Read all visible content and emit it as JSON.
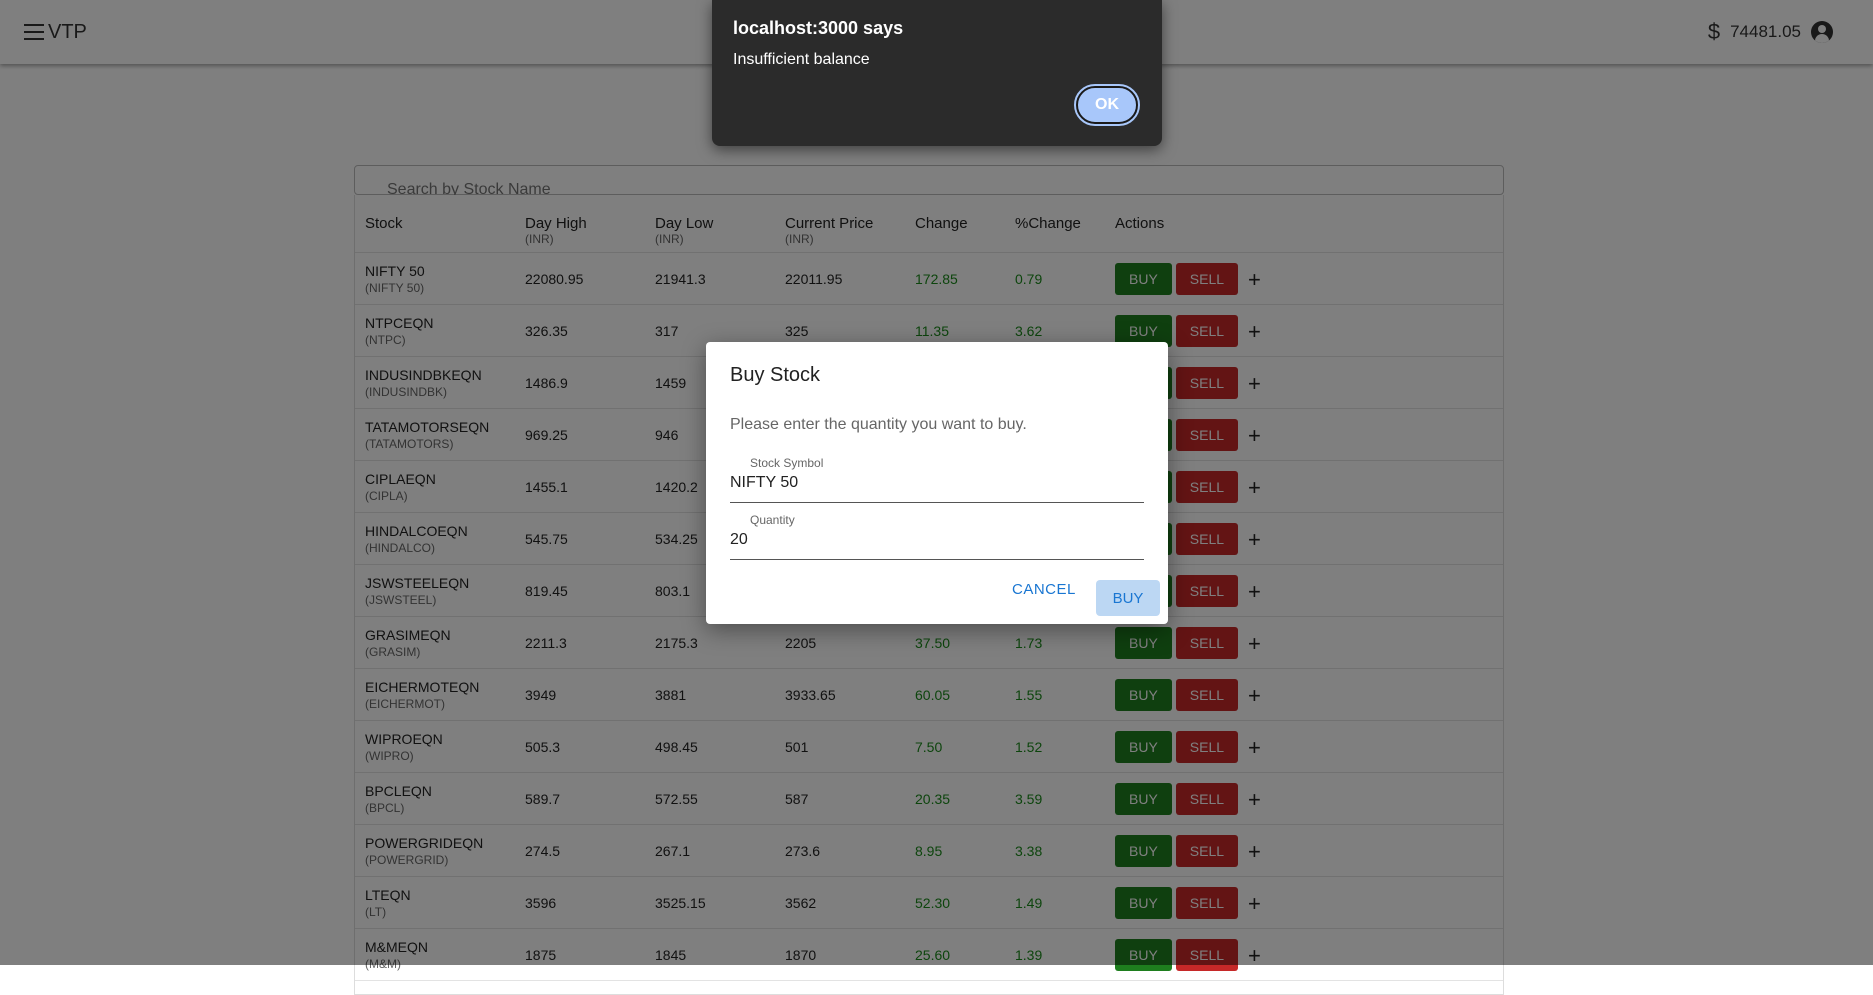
{
  "appbar": {
    "brand": "VTP",
    "balance": "74481.05",
    "icons": [
      "menu-icon",
      "dollar-icon",
      "account-icon"
    ]
  },
  "search": {
    "placeholder": "Search by Stock Name"
  },
  "table": {
    "headers": [
      {
        "label": "Stock",
        "unit": ""
      },
      {
        "label": "Day High",
        "unit": "(INR)"
      },
      {
        "label": "Day Low",
        "unit": "(INR)"
      },
      {
        "label": "Current Price",
        "unit": "(INR)"
      },
      {
        "label": "Change",
        "unit": ""
      },
      {
        "label": "%Change",
        "unit": ""
      },
      {
        "label": "Actions",
        "unit": ""
      }
    ],
    "buy_label": "BUY",
    "sell_label": "SELL",
    "rows": [
      {
        "name": "NIFTY 50",
        "symbol": "(NIFTY 50)",
        "high": "22080.95",
        "low": "21941.3",
        "current": "22011.95",
        "change": "172.85",
        "pct": "0.79"
      },
      {
        "name": "NTPCEQN",
        "symbol": "(NTPC)",
        "high": "326.35",
        "low": "317",
        "current": "325",
        "change": "11.35",
        "pct": "3.62"
      },
      {
        "name": "INDUSINDBKEQN",
        "symbol": "(INDUSINDBK)",
        "high": "1486.9",
        "low": "1459",
        "current": "",
        "change": "",
        "pct": ""
      },
      {
        "name": "TATAMOTORSEQN",
        "symbol": "(TATAMOTORS)",
        "high": "969.25",
        "low": "946",
        "current": "",
        "change": "",
        "pct": ""
      },
      {
        "name": "CIPLAEQN",
        "symbol": "(CIPLA)",
        "high": "1455.1",
        "low": "1420.2",
        "current": "",
        "change": "",
        "pct": ""
      },
      {
        "name": "HINDALCOEQN",
        "symbol": "(HINDALCO)",
        "high": "545.75",
        "low": "534.25",
        "current": "",
        "change": "",
        "pct": ""
      },
      {
        "name": "JSWSTEELEQN",
        "symbol": "(JSWSTEEL)",
        "high": "819.45",
        "low": "803.1",
        "current": "",
        "change": "",
        "pct": ""
      },
      {
        "name": "GRASIMEQN",
        "symbol": "(GRASIM)",
        "high": "2211.3",
        "low": "2175.3",
        "current": "2205",
        "change": "37.50",
        "pct": "1.73"
      },
      {
        "name": "EICHERMOTEQN",
        "symbol": "(EICHERMOT)",
        "high": "3949",
        "low": "3881",
        "current": "3933.65",
        "change": "60.05",
        "pct": "1.55"
      },
      {
        "name": "WIPROEQN",
        "symbol": "(WIPRO)",
        "high": "505.3",
        "low": "498.45",
        "current": "501",
        "change": "7.50",
        "pct": "1.52"
      },
      {
        "name": "BPCLEQN",
        "symbol": "(BPCL)",
        "high": "589.7",
        "low": "572.55",
        "current": "587",
        "change": "20.35",
        "pct": "3.59"
      },
      {
        "name": "POWERGRIDEQN",
        "symbol": "(POWERGRID)",
        "high": "274.5",
        "low": "267.1",
        "current": "273.6",
        "change": "8.95",
        "pct": "3.38"
      },
      {
        "name": "LTEQN",
        "symbol": "(LT)",
        "high": "3596",
        "low": "3525.15",
        "current": "3562",
        "change": "52.30",
        "pct": "1.49"
      },
      {
        "name": "M&MEQN",
        "symbol": "(M&M)",
        "high": "1875",
        "low": "1845",
        "current": "1870",
        "change": "25.60",
        "pct": "1.39"
      }
    ]
  },
  "dialog": {
    "title": "Buy Stock",
    "text": "Please enter the quantity you want to buy.",
    "symbol_label": "Stock Symbol",
    "symbol_value": "NIFTY 50",
    "qty_label": "Quantity",
    "qty_value": "20",
    "cancel_label": "CANCEL",
    "buy_label": "BUY"
  },
  "alert": {
    "title": "localhost:3000 says",
    "message": "Insufficient balance",
    "ok_label": "OK"
  },
  "colors": {
    "buy": "#1e7e1e",
    "sell": "#c62828",
    "positive": "#1b8a1b",
    "accent": "#1976d2"
  }
}
